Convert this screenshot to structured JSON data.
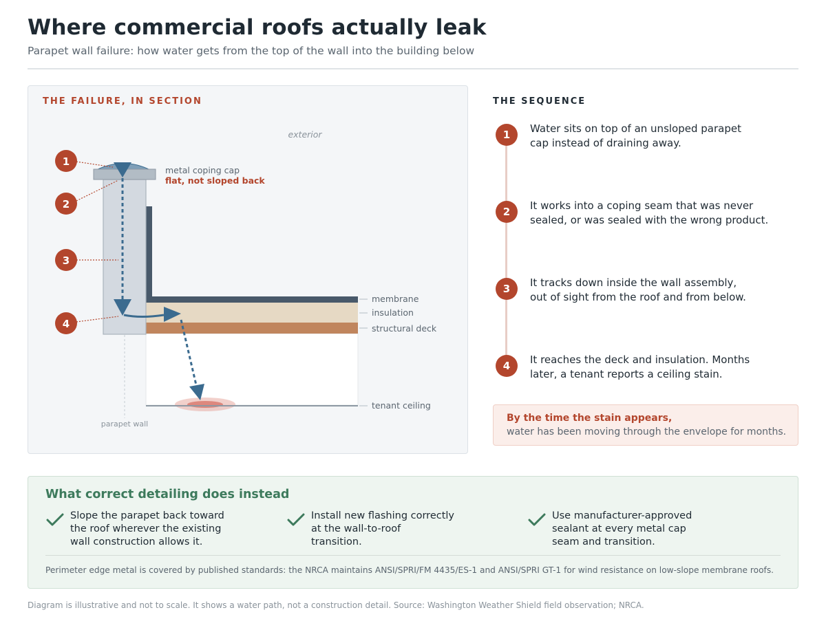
{
  "header": {
    "title": "Where commercial roofs actually leak",
    "subtitle": "Parapet wall failure: how water gets from the top of the wall into the building below"
  },
  "diagram": {
    "label": "THE FAILURE, IN SECTION",
    "exterior_label": "exterior",
    "coping_label": "metal coping cap",
    "coping_warning": "flat, not sloped back",
    "layers": {
      "membrane": "membrane",
      "insulation": "insulation",
      "deck": "structural deck",
      "ceiling": "tenant ceiling"
    },
    "wall_label": "parapet wall",
    "markers": [
      "1",
      "2",
      "3",
      "4"
    ]
  },
  "sequence": {
    "label": "THE SEQUENCE",
    "steps": [
      {
        "num": "1",
        "text": "Water sits on top of an unsloped parapet\ncap instead of draining away."
      },
      {
        "num": "2",
        "text": "It works into a coping seam that was never\nsealed, or was sealed with the wrong product."
      },
      {
        "num": "3",
        "text": "It tracks down inside the wall assembly,\nout of sight from the roof and from below."
      },
      {
        "num": "4",
        "text": "It reaches the deck and insulation. Months\nlater, a tenant reports a ceiling stain."
      }
    ],
    "callout_head": "By the time the stain appears,",
    "callout_body": "water has been moving through the envelope for months."
  },
  "fix": {
    "title": "What correct detailing does instead",
    "items": [
      "Slope the parapet back toward\nthe roof wherever the existing\nwall construction allows it.",
      "Install new flashing correctly\nat the wall-to-roof\ntransition.",
      "Use manufacturer-approved\nsealant at every metal cap\nseam and transition."
    ],
    "note": "Perimeter edge metal is covered by published standards: the NRCA maintains ANSI/SPRI/FM 4435/ES-1 and ANSI/SPRI GT-1 for wind resistance on low-slope membrane roofs."
  },
  "footer": "Diagram is illustrative and not to scale. It shows a water path, not a construction detail. Source: Washington Weather Shield field observation; NRCA.",
  "colors": {
    "accent_red": "#b3462d",
    "water_blue": "#3b6b8f",
    "fix_green": "#3d7a5c",
    "membrane": "#48596a",
    "insulation": "#e6d9c4",
    "deck": "#c0855d"
  }
}
